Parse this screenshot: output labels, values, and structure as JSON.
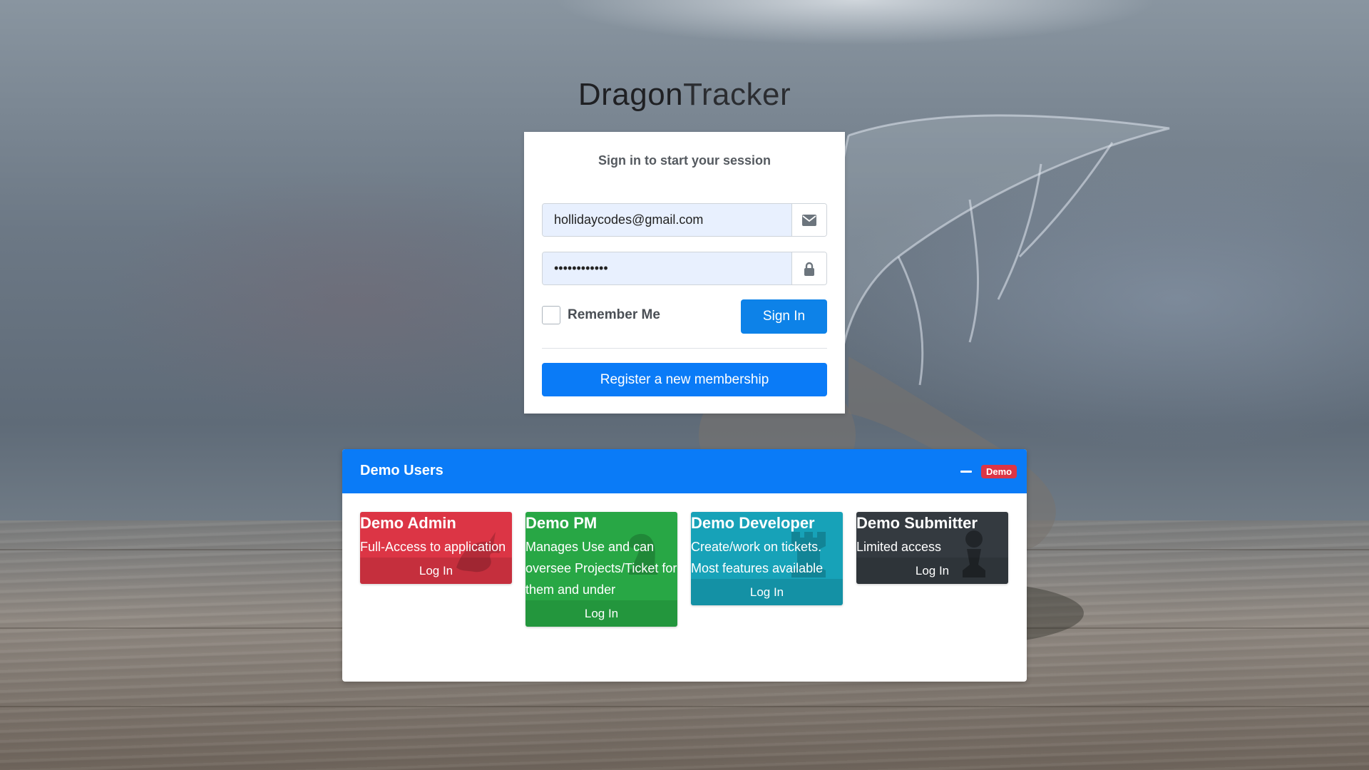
{
  "logo": {
    "part1": "Dragon",
    "part2": "Tracker"
  },
  "login": {
    "message": "Sign in to start your session",
    "email_value": "hollidaycodes@gmail.com",
    "email_icon": "envelope-icon",
    "password_value": "Password123!",
    "password_icon": "lock-icon",
    "remember_label": "Remember Me",
    "signin_label": "Sign In",
    "register_label": "Register a new membership"
  },
  "demo": {
    "title": "Demo Users",
    "collapse_icon": "minus-icon",
    "badge": "Demo",
    "tiles": [
      {
        "title": "Demo Admin",
        "desc": "Full-Access to application",
        "action": "Log In",
        "icon": "dragon-icon",
        "color": "#dc3545"
      },
      {
        "title": "Demo PM",
        "desc": "Manages Use and can oversee Projects/Ticket for them and under",
        "action": "Log In",
        "icon": "chess-knight-icon",
        "color": "#28a745"
      },
      {
        "title": "Demo Developer",
        "desc": "Create/work on tickets. Most features available",
        "action": "Log In",
        "icon": "chess-rook-icon",
        "color": "#17a2b8"
      },
      {
        "title": "Demo Submitter",
        "desc": "Limited access",
        "action": "Log In",
        "icon": "chess-pawn-icon",
        "color": "#343a40"
      }
    ]
  },
  "colors": {
    "primary": "#0a7bf7",
    "danger": "#dc3545",
    "success": "#28a745",
    "info": "#17a2b8",
    "dark": "#343a40"
  }
}
